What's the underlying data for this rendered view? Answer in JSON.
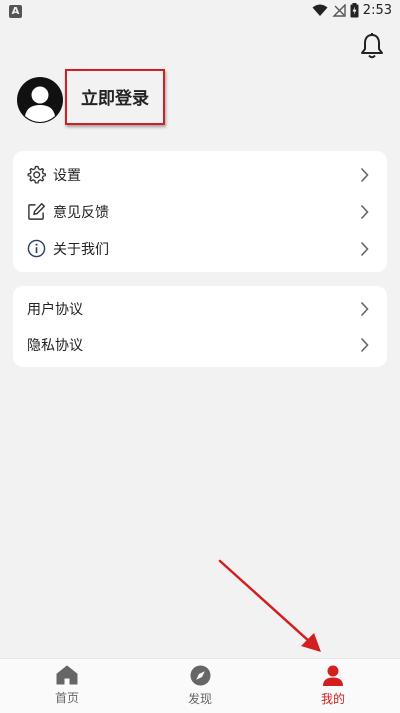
{
  "status": {
    "app_badge": "A",
    "time": "2:53"
  },
  "profile": {
    "login_label": "立即登录"
  },
  "menu_group_1": [
    {
      "icon": "gear-icon",
      "label": "设置"
    },
    {
      "icon": "edit-icon",
      "label": "意见反馈"
    },
    {
      "icon": "info-icon",
      "label": "关于我们"
    }
  ],
  "menu_group_2": [
    {
      "label": "用户协议"
    },
    {
      "label": "隐私协议"
    }
  ],
  "tabbar": {
    "tabs": [
      {
        "icon": "home-icon",
        "label": "首页",
        "active": false
      },
      {
        "icon": "compass-icon",
        "label": "发现",
        "active": false
      },
      {
        "icon": "user-icon",
        "label": "我的",
        "active": true
      }
    ]
  },
  "colors": {
    "accent": "#d21f1f",
    "inactive": "#666666",
    "card": "#ffffff",
    "background": "#f2f2f2"
  }
}
